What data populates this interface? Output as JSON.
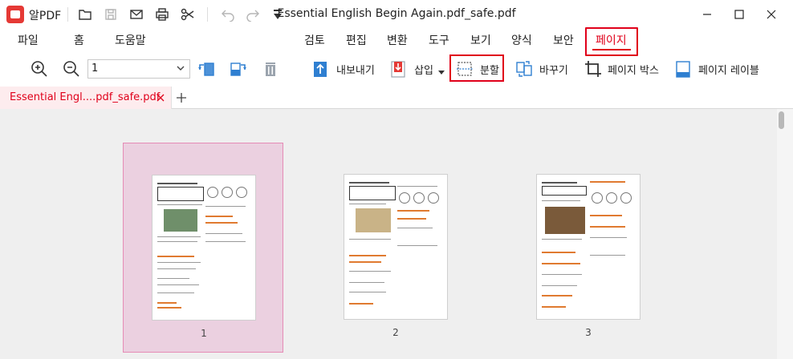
{
  "app": {
    "name": "알PDF"
  },
  "window": {
    "title": "Essential English Begin Again.pdf_safe.pdf"
  },
  "menu": {
    "left": [
      "파일",
      "홈",
      "도움말"
    ],
    "right": [
      "검토",
      "편집",
      "변환",
      "도구",
      "보기",
      "양식",
      "보안",
      "페이지"
    ],
    "active": "페이지"
  },
  "toolbar": {
    "page_value": "1",
    "export_label": "내보내기",
    "insert_label": "삽입",
    "split_label": "분할",
    "replace_label": "바꾸기",
    "pagebox_label": "페이지 박스",
    "pagelabel_label": "페이지 레이블"
  },
  "tabs": {
    "active_doc": "Essential Engl....pdf_safe.pdf"
  },
  "pages": [
    {
      "number": "1",
      "selected": true
    },
    {
      "number": "2",
      "selected": false
    },
    {
      "number": "3",
      "selected": false
    }
  ],
  "colors": {
    "accent": "#e0001a",
    "selected_bg": "#ebd0e0",
    "workspace": "#efefef"
  },
  "icons": [
    "app-logo-icon",
    "folder-icon",
    "save-icon",
    "mail-icon",
    "print-icon",
    "scissors-icon",
    "undo-icon",
    "redo-icon",
    "dropdown-icon",
    "minimize-icon",
    "maximize-icon",
    "close-icon",
    "zoom-in-icon",
    "zoom-out-icon",
    "rotate-left-icon",
    "rotate-right-icon",
    "delete-icon",
    "export-icon",
    "insert-icon",
    "split-icon",
    "replace-icon",
    "crop-icon",
    "page-label-icon",
    "tab-close-icon",
    "add-tab-icon"
  ]
}
